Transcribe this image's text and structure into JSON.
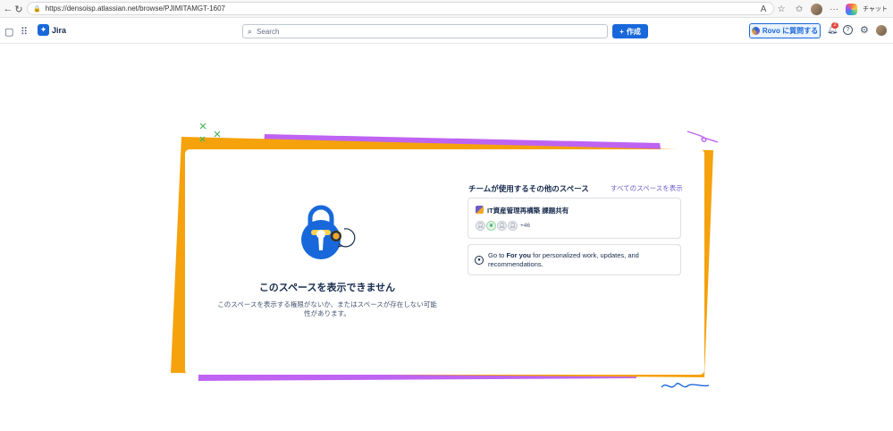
{
  "browser": {
    "url": "https://densoisp.atlassian.net/browse/PJIMITAMGT-1607",
    "chat_label": "チャット",
    "reload_icon": "reload-icon",
    "lock_icon": "lock-icon"
  },
  "header": {
    "app_name": "Jira",
    "search_placeholder": "Search",
    "create_label": "作成",
    "rovo_label": "Rovo に質問する",
    "notification_count": "2"
  },
  "error": {
    "title": "このスペースを表示できません",
    "description": "このスペースを表示する権限がないか、またはスペースが存在しない可能性があります。"
  },
  "other_spaces": {
    "heading": "チームが使用するその他のスペース",
    "view_all": "すべてのスペースを表示",
    "space": {
      "name": "IT資産管理再構築 課題共有",
      "member_count": "+46"
    }
  },
  "for_you": {
    "prefix": "Go to ",
    "link": "For you",
    "suffix": " for personalized work, updates, and recommendations."
  },
  "colors": {
    "primary": "#1868db",
    "orange": "#f5a20c",
    "purple": "#bf63f3",
    "link_purple": "#6e5dc6"
  }
}
